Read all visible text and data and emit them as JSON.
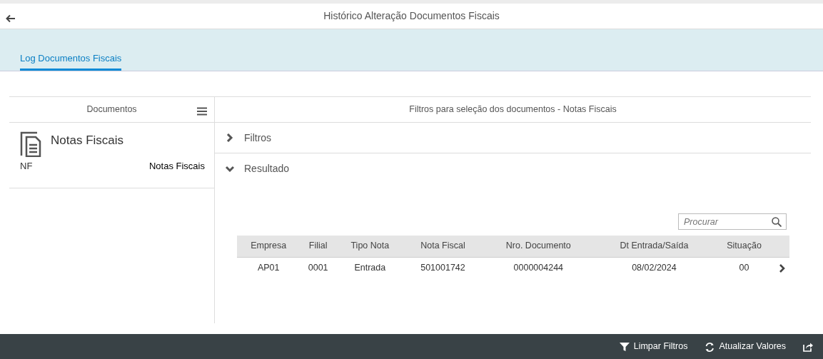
{
  "window": {
    "title": "Histórico Alteração Documentos Fiscais"
  },
  "tabs": [
    {
      "label": "Log Documentos Fiscais",
      "selected": true
    }
  ],
  "documents": {
    "header": "Documentos",
    "items": [
      {
        "title": "Notas Fiscais",
        "code": "NF",
        "description": "Notas Fiscais"
      }
    ]
  },
  "detail": {
    "header": "Filtros para seleção dos documentos - Notas Fiscais",
    "sections": [
      {
        "label": "Filtros",
        "expanded": false
      },
      {
        "label": "Resultado",
        "expanded": true
      }
    ],
    "search": {
      "placeholder": "Procurar"
    },
    "table": {
      "columns": [
        "Empresa",
        "Filial",
        "Tipo Nota",
        "Nota Fiscal",
        "Nro. Documento",
        "Dt Entrada/Saída",
        "Situação"
      ],
      "rows": [
        [
          "AP01",
          "0001",
          "Entrada",
          "501001742",
          "0000004244",
          "08/02/2024",
          "00"
        ]
      ]
    }
  },
  "footer": {
    "buttons": [
      {
        "kind": "filter",
        "label": "Limpar Filtros"
      },
      {
        "kind": "refresh",
        "label": "Atualizar Valores"
      },
      {
        "kind": "share"
      }
    ]
  }
}
